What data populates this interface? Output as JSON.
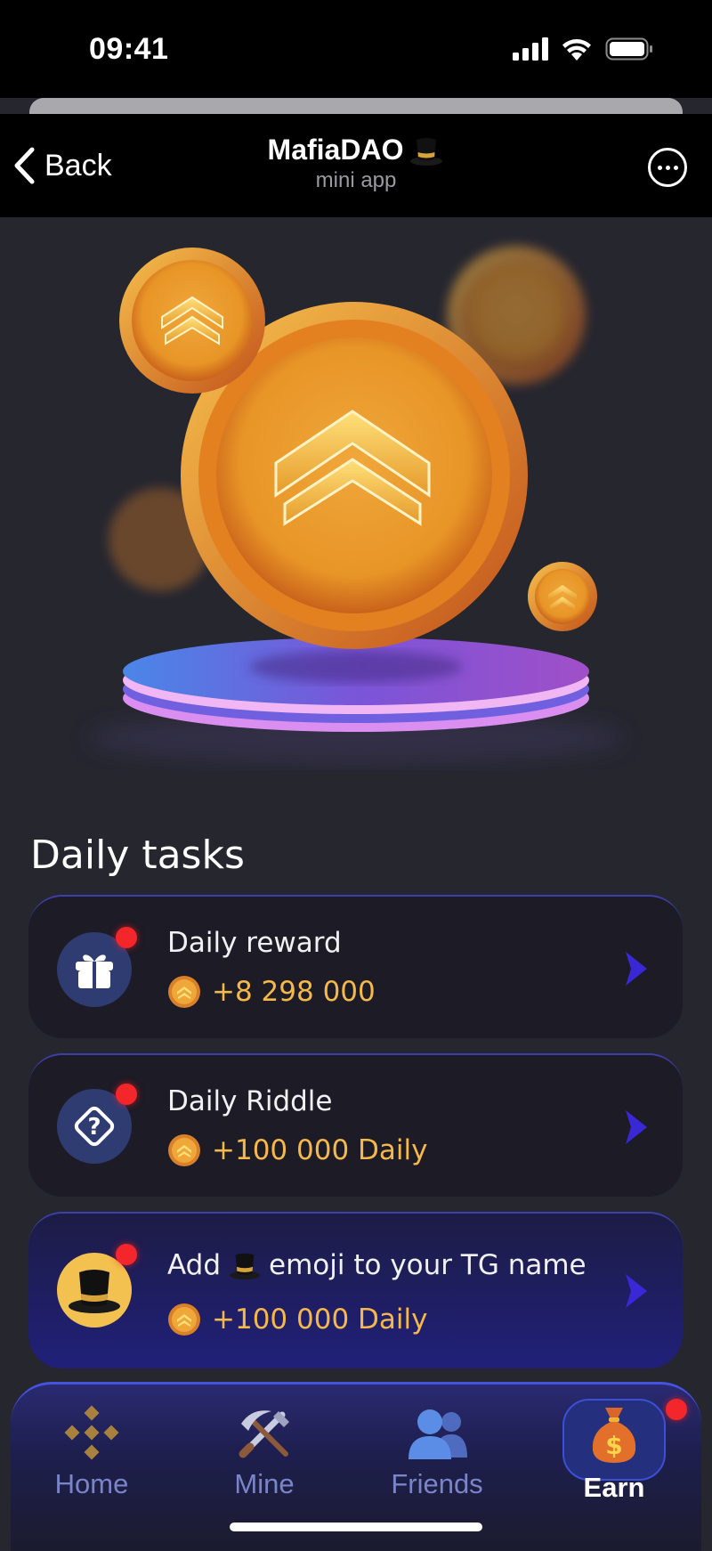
{
  "status_bar": {
    "time": "09:41"
  },
  "header": {
    "back_label": "Back",
    "title": "MafiaDAO",
    "subtitle": "mini app"
  },
  "section": {
    "title": "Daily tasks"
  },
  "tasks": [
    {
      "title": "Daily reward",
      "reward": "+8 298 000",
      "icon": "gift-icon",
      "has_badge": true
    },
    {
      "title": "Daily Riddle",
      "reward": "+100 000 Daily",
      "icon": "question-diamond-icon",
      "has_badge": true
    },
    {
      "title_before": "Add",
      "title_after": "emoji to your TG name",
      "reward": "+100 000 Daily",
      "icon": "top-hat-icon",
      "has_badge": true
    }
  ],
  "nav": {
    "items": [
      {
        "label": "Home",
        "icon": "binance-icon"
      },
      {
        "label": "Mine",
        "icon": "pickaxe-shovel-icon"
      },
      {
        "label": "Friends",
        "icon": "friends-icon"
      },
      {
        "label": "Earn",
        "icon": "money-bag-icon",
        "active": true
      }
    ]
  },
  "colors": {
    "accent": "#3b50d8",
    "reward_text": "#f5b84a",
    "badge": "#f2262b",
    "background": "#26262f"
  }
}
